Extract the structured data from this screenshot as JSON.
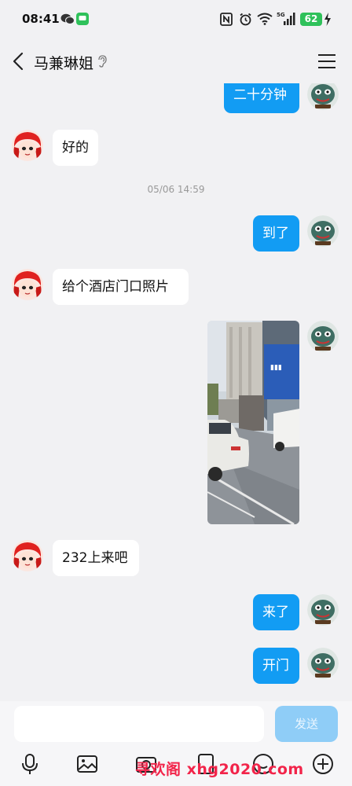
{
  "status_bar": {
    "time": "08:41",
    "battery": "62",
    "network": "5G"
  },
  "header": {
    "title": "马兼琳姐"
  },
  "messages": [
    {
      "side": "out",
      "text": "二十分钟"
    },
    {
      "side": "in",
      "text": "好的"
    },
    {
      "timestamp": "05/06 14:59"
    },
    {
      "side": "out",
      "text": "到了"
    },
    {
      "side": "in",
      "text": "给个酒店门口照片"
    },
    {
      "side": "out",
      "type": "image"
    },
    {
      "side": "in",
      "text": "232上来吧"
    },
    {
      "side": "out",
      "text": "来了"
    },
    {
      "side": "out",
      "text": "开门"
    }
  ],
  "input": {
    "placeholder": "",
    "send_label": "发送"
  },
  "watermark": "寻欢阁 xhg2020.com",
  "colors": {
    "accent": "#129cf3",
    "send_disabled": "#8fcdf7",
    "background": "#f1f1f3"
  }
}
